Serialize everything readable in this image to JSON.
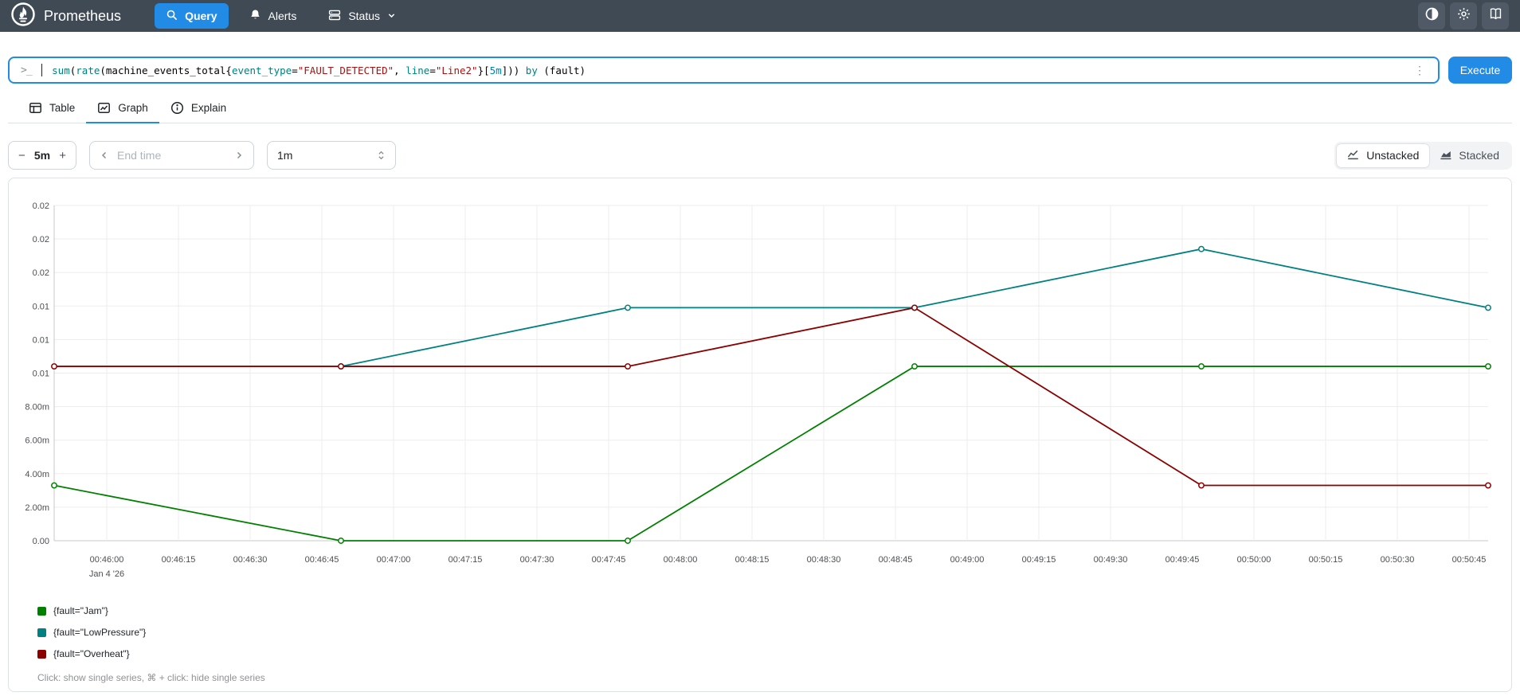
{
  "colors": {
    "accent": "#228be6",
    "navbar_bg": "#3f4a55",
    "navbar_button_bg": "#4f5a66",
    "panel_border": "#dee2e6",
    "control_border": "#ced4da",
    "muted_text": "#909296"
  },
  "syntax_colors": {
    "function": "#008080",
    "keyword": "#008080",
    "label": "#008080",
    "string": "#a31515",
    "duration": "#0086b3",
    "plain": "#000000"
  },
  "navbar": {
    "brand": "Prometheus",
    "items": [
      {
        "label": "Query",
        "icon": "search-icon",
        "active": true
      },
      {
        "label": "Alerts",
        "icon": "bell-icon",
        "active": false
      },
      {
        "label": "Status",
        "icon": "server-icon",
        "active": false,
        "chevron": true
      }
    ]
  },
  "query_bar": {
    "prompt": ">_",
    "kebab": "⋮",
    "execute_label": "Execute",
    "expression_text": "sum(rate(machine_events_total{event_type=\"FAULT_DETECTED\", line=\"Line2\"}[5m])) by (fault)",
    "expression_tokens": [
      {
        "text": "sum",
        "type": "function"
      },
      {
        "text": "(",
        "type": "plain"
      },
      {
        "text": "rate",
        "type": "function"
      },
      {
        "text": "(machine_events_total{",
        "type": "plain"
      },
      {
        "text": "event_type",
        "type": "label"
      },
      {
        "text": "=",
        "type": "plain"
      },
      {
        "text": "\"FAULT_DETECTED\"",
        "type": "string"
      },
      {
        "text": ", ",
        "type": "plain"
      },
      {
        "text": "line",
        "type": "label"
      },
      {
        "text": "=",
        "type": "plain"
      },
      {
        "text": "\"Line2\"",
        "type": "string"
      },
      {
        "text": "}[",
        "type": "plain"
      },
      {
        "text": "5m",
        "type": "duration"
      },
      {
        "text": "])) ",
        "type": "plain"
      },
      {
        "text": "by",
        "type": "keyword"
      },
      {
        "text": " (fault)",
        "type": "plain"
      }
    ]
  },
  "tabs": [
    {
      "label": "Table",
      "icon": "table-icon",
      "active": false
    },
    {
      "label": "Graph",
      "icon": "graph-icon",
      "active": true
    },
    {
      "label": "Explain",
      "icon": "info-icon",
      "active": false
    }
  ],
  "controls": {
    "range": {
      "decrease": "−",
      "value": "5m",
      "increase": "+"
    },
    "end_time": {
      "placeholder": "End time"
    },
    "resolution": {
      "value": "1m"
    },
    "stacking": {
      "options": [
        {
          "label": "Unstacked",
          "icon": "line-chart-icon",
          "active": true
        },
        {
          "label": "Stacked",
          "icon": "area-chart-icon",
          "active": false
        }
      ]
    }
  },
  "chart_data": {
    "type": "line",
    "title": "",
    "xlabel": "",
    "ylabel": "",
    "ylim": [
      0,
      0.02
    ],
    "grid": true,
    "legend_position": "bottom-left",
    "y_ticks": [
      "0.02",
      "0.02",
      "0.02",
      "0.01",
      "0.01",
      "0.01",
      "8.00m",
      "6.00m",
      "4.00m",
      "2.00m",
      "0.00"
    ],
    "x_tick_labels": [
      "00:46:00",
      "00:46:15",
      "00:46:30",
      "00:46:45",
      "00:47:00",
      "00:47:15",
      "00:47:30",
      "00:47:45",
      "00:48:00",
      "00:48:15",
      "00:48:30",
      "00:48:45",
      "00:49:00",
      "00:49:15",
      "00:49:30",
      "00:49:45",
      "00:50:00",
      "00:50:15",
      "00:50:30",
      "00:50:45"
    ],
    "x_axis_date": "Jan 4 '26",
    "x_start_offset_seconds": 11,
    "x_tick_interval_seconds": 15,
    "x_range_seconds": 300,
    "sample_interval_seconds": 60,
    "sample_times": [
      "00:45:49",
      "00:46:49",
      "00:47:49",
      "00:48:49",
      "00:49:49",
      "00:50:49"
    ],
    "series": [
      {
        "name": "{fault=\"Jam\"}",
        "color": "#008000",
        "values": [
          0.0033,
          0,
          0,
          0.0104,
          0.0104,
          0.0104
        ]
      },
      {
        "name": "{fault=\"LowPressure\"}",
        "color": "#008080",
        "values": [
          null,
          0.0104,
          0.0139,
          0.0139,
          0.0174,
          0.0139
        ]
      },
      {
        "name": "{fault=\"Overheat\"}",
        "color": "#8b0000",
        "values": [
          0.0104,
          0.0104,
          0.0104,
          0.0139,
          0.0033,
          0.0033
        ]
      }
    ],
    "legend_hint": "Click: show single series, ⌘ + click: hide single series"
  }
}
